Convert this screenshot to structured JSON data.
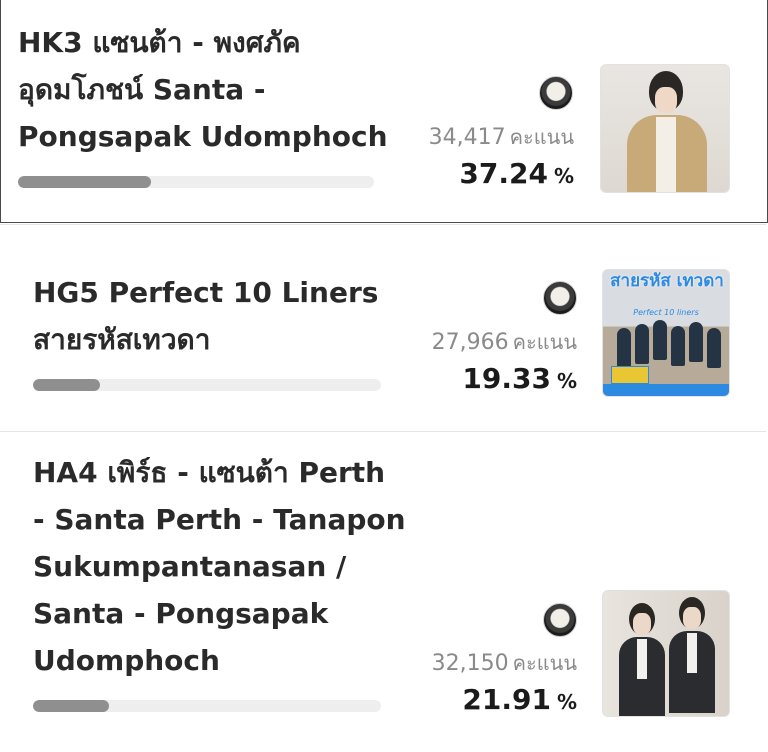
{
  "unit_label": "คะแนน",
  "percent_sign": "%",
  "entries": [
    {
      "title_lines": [
        "HK3 แซนต้า - พงศภัค",
        "อุดมโภชน์ Santa -",
        "Pongsapak Udomphoch"
      ],
      "votes": "34,417",
      "percent": "37.24",
      "percent_value": 37.24,
      "thumbnail": "portrait-photo",
      "avatar": "user-avatar-icon"
    },
    {
      "title_lines": [
        "HG5 Perfect 10 Liners",
        "สายรหัสเทวดา"
      ],
      "votes": "27,966",
      "percent": "19.33",
      "percent_value": 19.33,
      "thumbnail": "series-poster",
      "poster_title": "สายรหัส เทวดา",
      "poster_subtitle": "Perfect 10 liners",
      "avatar": "user-avatar-icon"
    },
    {
      "title_lines": [
        "HA4 เพิร์ธ - แซนต้า Perth",
        "- Santa Perth - Tanapon",
        "Sukumpantanasan /",
        "Santa - Pongsapak",
        "Udomphoch"
      ],
      "votes": "32,150",
      "percent": "21.91",
      "percent_value": 21.91,
      "thumbnail": "duo-photo",
      "avatar": "user-avatar-icon"
    }
  ],
  "colors": {
    "bar_fill": "#8f8f8f",
    "bar_track": "#eeeeee",
    "poster_accent": "#2c8ae0"
  }
}
